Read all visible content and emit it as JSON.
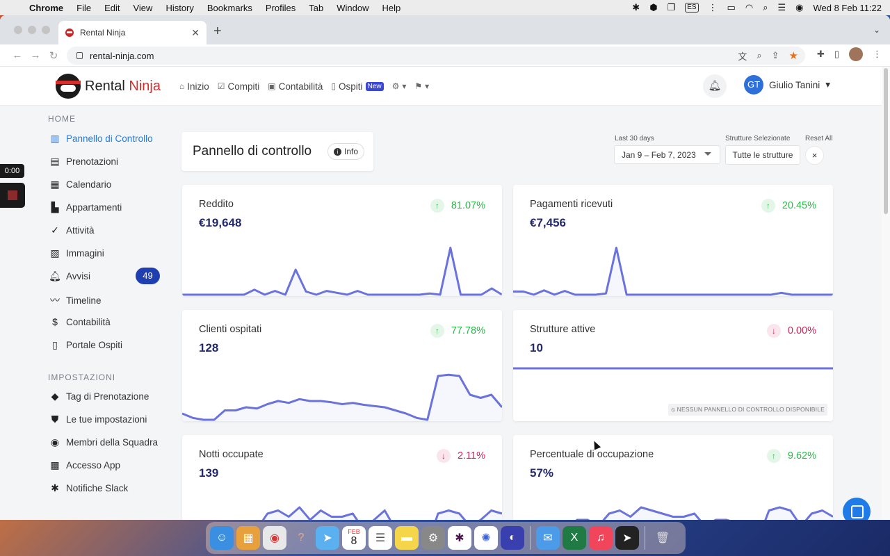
{
  "menubar": {
    "app": "Chrome",
    "items": [
      "File",
      "Edit",
      "View",
      "History",
      "Bookmarks",
      "Profiles",
      "Tab",
      "Window",
      "Help"
    ],
    "input_source": "ES",
    "datetime": "Wed 8 Feb  11:22"
  },
  "browser": {
    "tab_title": "Rental Ninja",
    "url": "rental-ninja.com"
  },
  "app": {
    "logo_text_1": "Rental",
    "logo_text_2": "Ninja",
    "nav": {
      "inizio": "Inizio",
      "compiti": "Compiti",
      "contabilita": "Contabilità",
      "ospiti": "Ospiti",
      "new_badge": "New"
    },
    "user": {
      "initials": "GT",
      "name": "Giulio Tanini"
    }
  },
  "sidebar": {
    "home_title": "HOME",
    "home_items": [
      {
        "label": "Pannello di Controllo",
        "icon": "bar-chart-icon"
      },
      {
        "label": "Prenotazioni",
        "icon": "list-icon"
      },
      {
        "label": "Calendario",
        "icon": "calendar-icon"
      },
      {
        "label": "Appartamenti",
        "icon": "building-icon"
      },
      {
        "label": "Attività",
        "icon": "double-check-icon"
      },
      {
        "label": "Immagini",
        "icon": "image-icon"
      },
      {
        "label": "Avvisi",
        "icon": "bell-icon",
        "badge": "49"
      },
      {
        "label": "Timeline",
        "icon": "trend-icon"
      },
      {
        "label": "Contabilità",
        "icon": "money-icon"
      },
      {
        "label": "Portale Ospiti",
        "icon": "phone-icon"
      }
    ],
    "settings_title": "IMPOSTAZIONI",
    "settings_items": [
      {
        "label": "Tag di Prenotazione",
        "icon": "tag-icon"
      },
      {
        "label": "Le tue impostazioni",
        "icon": "shield-icon"
      },
      {
        "label": "Membri della Squadra",
        "icon": "team-icon"
      },
      {
        "label": "Accesso App",
        "icon": "qr-icon"
      },
      {
        "label": "Notifiche Slack",
        "icon": "slack-icon"
      }
    ]
  },
  "recorder": {
    "time": "0:00"
  },
  "dashboard": {
    "title": "Pannello di controllo",
    "info_label": "Info",
    "date_label": "Last 30 days",
    "date_range": "Jan 9 – Feb 7, 2023",
    "structures_label": "Strutture Selezionate",
    "structures_value": "Tutte le strutture",
    "reset_label": "Reset All",
    "reset_x": "×"
  },
  "cards": [
    {
      "title": "Reddito",
      "value": "€19,648",
      "change": "81.07%",
      "direction": "up",
      "spark": [
        0,
        0,
        0,
        0,
        0,
        0,
        0,
        0.08,
        0,
        0.06,
        0,
        0.4,
        0.05,
        0,
        0.06,
        0.03,
        0,
        0.06,
        0,
        0,
        0,
        0,
        0,
        0,
        0.02,
        0,
        0.75,
        0,
        0,
        0,
        0.1,
        0
      ]
    },
    {
      "title": "Pagamenti ricevuti",
      "value": "€7,456",
      "change": "20.45%",
      "direction": "up",
      "spark": [
        0.05,
        0.05,
        0,
        0.07,
        0,
        0.06,
        0,
        0,
        0,
        0.02,
        0.75,
        0,
        0,
        0,
        0,
        0,
        0,
        0,
        0,
        0,
        0,
        0,
        0,
        0,
        0,
        0,
        0.03,
        0,
        0,
        0,
        0,
        0
      ]
    },
    {
      "title": "Clienti ospitati",
      "value": "128",
      "change": "77.78%",
      "direction": "up",
      "spark": [
        0.1,
        0.03,
        0,
        0,
        0.15,
        0.15,
        0.2,
        0.18,
        0.25,
        0.3,
        0.27,
        0.33,
        0.3,
        0.3,
        0.28,
        0.25,
        0.27,
        0.24,
        0.22,
        0.2,
        0.15,
        0.1,
        0.03,
        0,
        0.7,
        0.72,
        0.7,
        0.4,
        0.35,
        0.4,
        0.2
      ]
    },
    {
      "title": "Strutture attive",
      "value": "10",
      "change": "0.00%",
      "direction": "down",
      "no_panel": "NESSUN PANNELLO DI CONTROLLO DISPONIBILE"
    },
    {
      "title": "Notti occupate",
      "value": "139",
      "change": "2.11%",
      "direction": "down",
      "spark": [
        0.3,
        0.2,
        0.1,
        0.12,
        0.1,
        0.35,
        0.35,
        0.25,
        0.5,
        0.55,
        0.45,
        0.6,
        0.4,
        0.55,
        0.45,
        0.45,
        0.5,
        0.25,
        0.4,
        0.55,
        0.25,
        0.15,
        0.05,
        0,
        0.5,
        0.55,
        0.5,
        0.3,
        0.4,
        0.55,
        0.5
      ]
    },
    {
      "title": "Percentuale di occupazione",
      "value": "57%",
      "change": "9.62%",
      "direction": "up",
      "spark": [
        0.3,
        0.3,
        0.25,
        0.3,
        0.2,
        0.25,
        0.4,
        0.4,
        0.3,
        0.5,
        0.55,
        0.45,
        0.6,
        0.55,
        0.5,
        0.45,
        0.45,
        0.5,
        0.3,
        0.4,
        0.4,
        0.35,
        0.25,
        0.1,
        0.55,
        0.6,
        0.55,
        0.3,
        0.5,
        0.55,
        0.45
      ]
    }
  ],
  "dock": {
    "calendar_month": "FEB",
    "calendar_day": "8"
  }
}
